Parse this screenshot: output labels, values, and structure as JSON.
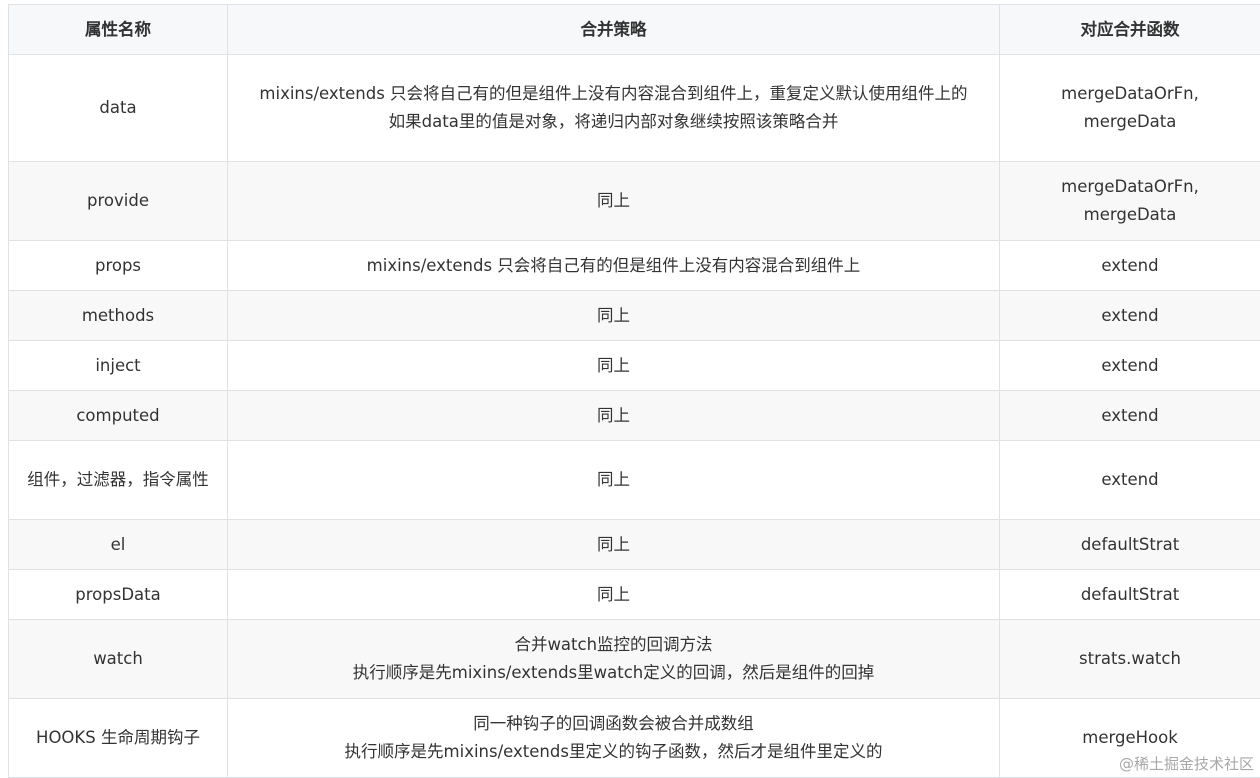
{
  "table": {
    "headers": [
      "属性名称",
      "合并策略",
      "对应合并函数"
    ],
    "rows": [
      {
        "name": "data",
        "strategy": [
          "mixins/extends 只会将自己有的但是组件上没有内容混合到组件上，重复定义默认使用组件上的",
          "如果data里的值是对象，将递归内部对象继续按照该策略合并"
        ],
        "fn": [
          "mergeDataOrFn,",
          "mergeData"
        ]
      },
      {
        "name": "provide",
        "strategy": [
          "同上"
        ],
        "fn": [
          "mergeDataOrFn,",
          "mergeData"
        ]
      },
      {
        "name": "props",
        "strategy": [
          "mixins/extends 只会将自己有的但是组件上没有内容混合到组件上"
        ],
        "fn": [
          "extend"
        ]
      },
      {
        "name": "methods",
        "strategy": [
          "同上"
        ],
        "fn": [
          "extend"
        ]
      },
      {
        "name": "inject",
        "strategy": [
          "同上"
        ],
        "fn": [
          "extend"
        ]
      },
      {
        "name": "computed",
        "strategy": [
          "同上"
        ],
        "fn": [
          "extend"
        ]
      },
      {
        "name": "组件，过滤器，指令属性",
        "strategy": [
          "同上"
        ],
        "fn": [
          "extend"
        ]
      },
      {
        "name": "el",
        "strategy": [
          "同上"
        ],
        "fn": [
          "defaultStrat"
        ]
      },
      {
        "name": "propsData",
        "strategy": [
          "同上"
        ],
        "fn": [
          "defaultStrat"
        ]
      },
      {
        "name": "watch",
        "strategy": [
          "合并watch监控的回调方法",
          "执行顺序是先mixins/extends里watch定义的回调，然后是组件的回掉"
        ],
        "fn": [
          "strats.watch"
        ]
      },
      {
        "name": "HOOKS 生命周期钩子",
        "strategy": [
          "同一种钩子的回调函数会被合并成数组",
          "执行顺序是先mixins/extends里定义的钩子函数，然后才是组件里定义的"
        ],
        "fn": [
          "mergeHook"
        ]
      }
    ]
  },
  "watermark": "@稀土掘金技术社区"
}
